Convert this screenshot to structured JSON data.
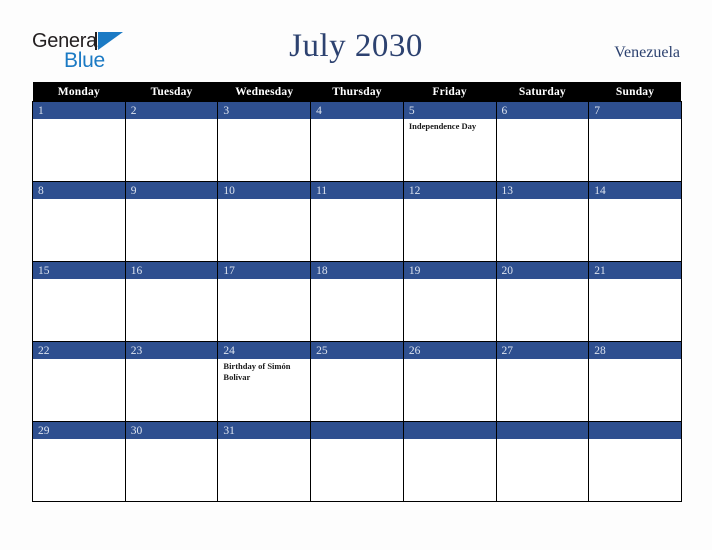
{
  "header": {
    "logo": {
      "line1": "General",
      "line2": "Blue",
      "triangle_color": "#1b7ac4",
      "text_color": "#231f20"
    },
    "title": "July 2030",
    "country": "Venezuela",
    "title_color": "#2d4270"
  },
  "calendar": {
    "weekday_headers": [
      "Monday",
      "Tuesday",
      "Wednesday",
      "Thursday",
      "Friday",
      "Saturday",
      "Sunday"
    ],
    "header_bg": "#000000",
    "date_band_bg": "#2e4f8f",
    "date_text_color": "#dbe2ee",
    "weeks": [
      {
        "days": [
          {
            "num": "1",
            "event": ""
          },
          {
            "num": "2",
            "event": ""
          },
          {
            "num": "3",
            "event": ""
          },
          {
            "num": "4",
            "event": ""
          },
          {
            "num": "5",
            "event": "Independence Day"
          },
          {
            "num": "6",
            "event": ""
          },
          {
            "num": "7",
            "event": ""
          }
        ]
      },
      {
        "days": [
          {
            "num": "8",
            "event": ""
          },
          {
            "num": "9",
            "event": ""
          },
          {
            "num": "10",
            "event": ""
          },
          {
            "num": "11",
            "event": ""
          },
          {
            "num": "12",
            "event": ""
          },
          {
            "num": "13",
            "event": ""
          },
          {
            "num": "14",
            "event": ""
          }
        ]
      },
      {
        "days": [
          {
            "num": "15",
            "event": ""
          },
          {
            "num": "16",
            "event": ""
          },
          {
            "num": "17",
            "event": ""
          },
          {
            "num": "18",
            "event": ""
          },
          {
            "num": "19",
            "event": ""
          },
          {
            "num": "20",
            "event": ""
          },
          {
            "num": "21",
            "event": ""
          }
        ]
      },
      {
        "days": [
          {
            "num": "22",
            "event": ""
          },
          {
            "num": "23",
            "event": ""
          },
          {
            "num": "24",
            "event": "Birthday of Simón Bolívar"
          },
          {
            "num": "25",
            "event": ""
          },
          {
            "num": "26",
            "event": ""
          },
          {
            "num": "27",
            "event": ""
          },
          {
            "num": "28",
            "event": ""
          }
        ]
      },
      {
        "days": [
          {
            "num": "29",
            "event": ""
          },
          {
            "num": "30",
            "event": ""
          },
          {
            "num": "31",
            "event": ""
          },
          {
            "num": "",
            "event": ""
          },
          {
            "num": "",
            "event": ""
          },
          {
            "num": "",
            "event": ""
          },
          {
            "num": "",
            "event": ""
          }
        ]
      }
    ]
  }
}
